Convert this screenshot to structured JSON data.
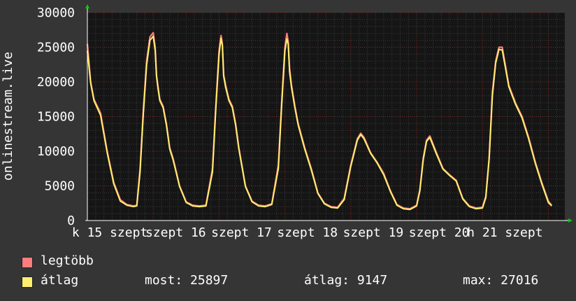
{
  "chart_data": {
    "type": "line",
    "ylabel": "onlinestream.live",
    "ylim": [
      0,
      30000
    ],
    "yticks": [
      "0",
      "5000",
      "10000",
      "15000",
      "20000",
      "25000",
      "30000"
    ],
    "xticklabels": [
      "k 15 szept",
      "szept 16",
      "szept 17",
      "szept 18",
      "szept 19",
      "szept 20",
      "h 21 szept"
    ],
    "grid": true,
    "legend_position": "bottom",
    "colors": {
      "background": "#353535",
      "plot_bg": "#151515",
      "max_line": "#ff6f6f",
      "avg_line": "#ffef6f",
      "grid_major": "#5a2a2a",
      "grid_minor": "#3c3c3c"
    },
    "series": [
      {
        "name": "legtöbb",
        "color": "#ff7c7c",
        "x": [
          0,
          0.05,
          0.1,
          0.2,
          0.3,
          0.4,
          0.5,
          0.6,
          0.7,
          0.75,
          0.8,
          0.85,
          0.9,
          0.95,
          1.0,
          1.03,
          1.05,
          1.07,
          1.1,
          1.15,
          1.2,
          1.25,
          1.3,
          1.4,
          1.5,
          1.6,
          1.7,
          1.8,
          1.9,
          1.95,
          2.0,
          2.03,
          2.05,
          2.07,
          2.1,
          2.15,
          2.2,
          2.25,
          2.3,
          2.4,
          2.5,
          2.6,
          2.7,
          2.8,
          2.9,
          2.95,
          3.0,
          3.03,
          3.05,
          3.07,
          3.1,
          3.15,
          3.2,
          3.3,
          3.4,
          3.5,
          3.6,
          3.7,
          3.8,
          3.9,
          4.0,
          4.1,
          4.15,
          4.2,
          4.3,
          4.4,
          4.5,
          4.6,
          4.7,
          4.8,
          4.9,
          5.0,
          5.05,
          5.1,
          5.15,
          5.2,
          5.3,
          5.4,
          5.5,
          5.6,
          5.7,
          5.8,
          5.9,
          6.0,
          6.05,
          6.1,
          6.15,
          6.2,
          6.25,
          6.3,
          6.4,
          6.5,
          6.6,
          6.7,
          6.8,
          6.9,
          7.0,
          7.05
        ],
        "values": [
          25500,
          20000,
          17500,
          15500,
          10000,
          5500,
          3000,
          2300,
          2100,
          2200,
          7500,
          16000,
          23000,
          26500,
          27100,
          25000,
          21000,
          19500,
          17500,
          16500,
          14000,
          10500,
          9000,
          5000,
          2700,
          2200,
          2100,
          2200,
          7500,
          16500,
          24500,
          26700,
          25500,
          21000,
          19500,
          17500,
          16500,
          14000,
          10500,
          5000,
          2800,
          2200,
          2100,
          2400,
          8000,
          17000,
          25000,
          27000,
          25800,
          22000,
          19500,
          16500,
          14000,
          10500,
          7500,
          4000,
          2500,
          2000,
          1900,
          3200,
          8000,
          11800,
          12600,
          12000,
          9800,
          8400,
          6800,
          4300,
          2300,
          1800,
          1700,
          2200,
          4500,
          9000,
          11600,
          12200,
          9800,
          7500,
          6600,
          5800,
          3200,
          2100,
          1800,
          1900,
          3500,
          9000,
          18500,
          23000,
          25000,
          25000,
          19500,
          17000,
          15000,
          12000,
          8500,
          5500,
          2800,
          2200
        ]
      },
      {
        "name": "átlag",
        "color": "#ffef6f",
        "x": [
          0,
          0.05,
          0.1,
          0.2,
          0.3,
          0.4,
          0.5,
          0.6,
          0.7,
          0.75,
          0.8,
          0.85,
          0.9,
          0.95,
          1.0,
          1.03,
          1.05,
          1.07,
          1.1,
          1.15,
          1.2,
          1.25,
          1.3,
          1.4,
          1.5,
          1.6,
          1.7,
          1.8,
          1.9,
          1.95,
          2.0,
          2.03,
          2.05,
          2.07,
          2.1,
          2.15,
          2.2,
          2.25,
          2.3,
          2.4,
          2.5,
          2.6,
          2.7,
          2.8,
          2.9,
          2.95,
          3.0,
          3.03,
          3.05,
          3.07,
          3.1,
          3.15,
          3.2,
          3.3,
          3.4,
          3.5,
          3.6,
          3.7,
          3.8,
          3.9,
          4.0,
          4.1,
          4.15,
          4.2,
          4.3,
          4.4,
          4.5,
          4.6,
          4.7,
          4.8,
          4.9,
          5.0,
          5.05,
          5.1,
          5.15,
          5.2,
          5.3,
          5.4,
          5.5,
          5.6,
          5.7,
          5.8,
          5.9,
          6.0,
          6.05,
          6.1,
          6.15,
          6.2,
          6.25,
          6.3,
          6.4,
          6.5,
          6.6,
          6.7,
          6.8,
          6.9,
          7.0,
          7.05
        ],
        "values": [
          24500,
          19800,
          17300,
          15200,
          9800,
          5300,
          2800,
          2200,
          2000,
          2100,
          7000,
          15500,
          22500,
          26000,
          26600,
          24500,
          20800,
          19200,
          17300,
          16300,
          13800,
          10300,
          8800,
          4900,
          2600,
          2100,
          2000,
          2100,
          7000,
          16000,
          24000,
          26300,
          25200,
          20800,
          19200,
          17300,
          16300,
          13800,
          10300,
          4900,
          2700,
          2100,
          2000,
          2300,
          7500,
          16500,
          24500,
          26200,
          25500,
          21500,
          19200,
          16300,
          13800,
          10300,
          7300,
          3900,
          2400,
          1900,
          1800,
          3000,
          7800,
          11600,
          12400,
          11800,
          9700,
          8300,
          6600,
          4200,
          2200,
          1700,
          1600,
          2100,
          4300,
          8800,
          11400,
          12000,
          9600,
          7400,
          6500,
          5700,
          3100,
          2000,
          1700,
          1800,
          3300,
          8800,
          18000,
          22700,
          24700,
          24600,
          19300,
          16800,
          14800,
          11800,
          8300,
          5300,
          2600,
          2100
        ]
      }
    ],
    "x_domain": [
      0,
      7.25
    ],
    "stats": {
      "most": "most: 25897",
      "atlag": "átlag: 9147",
      "max": "max: 27016"
    }
  },
  "legend": {
    "max_label": "legtöbb",
    "avg_label": "átlag"
  }
}
